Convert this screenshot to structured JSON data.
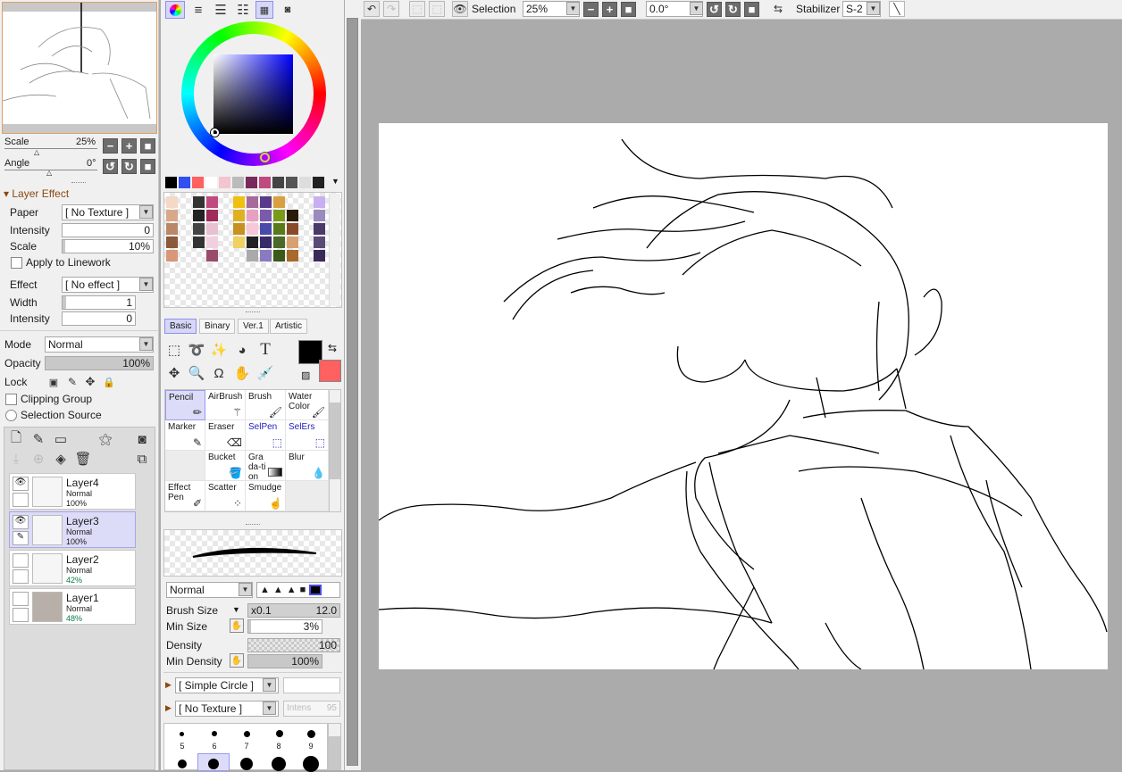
{
  "navigator": {
    "scale_label": "Scale",
    "scale_value": "25%",
    "angle_label": "Angle",
    "angle_value": "0°"
  },
  "layer_effect": {
    "header": "Layer Effect",
    "paper_label": "Paper",
    "paper_value": "[ No Texture ]",
    "intensity_label": "Intensity",
    "intensity_value": "0",
    "scale_label": "Scale",
    "scale_value": "10%",
    "apply_linework_label": "Apply to Linework",
    "effect_label": "Effect",
    "effect_value": "[ No effect ]",
    "width_label": "Width",
    "width_value": "1",
    "intensity2_label": "Intensity",
    "intensity2_value": "0"
  },
  "layer_props": {
    "mode_label": "Mode",
    "mode_value": "Normal",
    "opacity_label": "Opacity",
    "opacity_value": "100%",
    "lock_label": "Lock",
    "clipping_label": "Clipping Group",
    "selection_source_label": "Selection Source"
  },
  "layers": [
    {
      "name": "Layer4",
      "mode": "Normal",
      "opacity": "100%",
      "selected": false
    },
    {
      "name": "Layer3",
      "mode": "Normal",
      "opacity": "100%",
      "selected": true
    },
    {
      "name": "Layer2",
      "mode": "Normal",
      "opacity": "42%",
      "selected": false
    },
    {
      "name": "Layer1",
      "mode": "Normal",
      "opacity": "48%",
      "selected": false
    }
  ],
  "colors": {
    "primary": "#000000",
    "secondary": "#ff6060",
    "accent_selected": "#dcdcf8",
    "effect_header": "#8a4a10",
    "opacity_green": "#0a7a4a"
  },
  "tool_tabs": [
    "Basic",
    "Binary",
    "Ver.1",
    "Artistic"
  ],
  "tools": [
    {
      "name": "Pencil",
      "icon": "pencil-icon"
    },
    {
      "name": "AirBrush",
      "icon": "airbrush-icon"
    },
    {
      "name": "Brush",
      "icon": "brush-icon"
    },
    {
      "name": "Water Color",
      "icon": "watercolor-icon"
    },
    {
      "name": "Marker",
      "icon": "marker-icon"
    },
    {
      "name": "Eraser",
      "icon": "eraser-icon"
    },
    {
      "name": "SelPen",
      "icon": "selpen-icon"
    },
    {
      "name": "SelErs",
      "icon": "selers-icon"
    },
    {
      "name": "",
      "icon": ""
    },
    {
      "name": "Bucket",
      "icon": "bucket-icon"
    },
    {
      "name": "Grada-tion",
      "icon": "gradation-icon"
    },
    {
      "name": "Blur",
      "icon": "blur-icon"
    },
    {
      "name": "Effect Pen",
      "icon": "effect-pen-icon"
    },
    {
      "name": "Scatter",
      "icon": "scatter-icon"
    },
    {
      "name": "Smudge",
      "icon": "smudge-icon"
    },
    {
      "name": "",
      "icon": ""
    }
  ],
  "brush": {
    "blend_mode": "Normal",
    "size_label": "Brush Size",
    "size_mult": "x0.1",
    "size_value": "12.0",
    "min_size_label": "Min Size",
    "min_size_value": "3%",
    "density_label": "Density",
    "density_value": "100",
    "min_density_label": "Min Density",
    "min_density_value": "100%",
    "shape": "[ Simple Circle ]",
    "texture": "[ No Texture ]",
    "intens_label": "Intens",
    "intens_value": "95",
    "size_presets": [
      "5",
      "6",
      "7",
      "8",
      "9"
    ]
  },
  "toolbar": {
    "selection_label": "Selection",
    "zoom_value": "25%",
    "rotation_value": "0.0°",
    "stabilizer_label": "Stabilizer",
    "stabilizer_value": "S-2"
  }
}
